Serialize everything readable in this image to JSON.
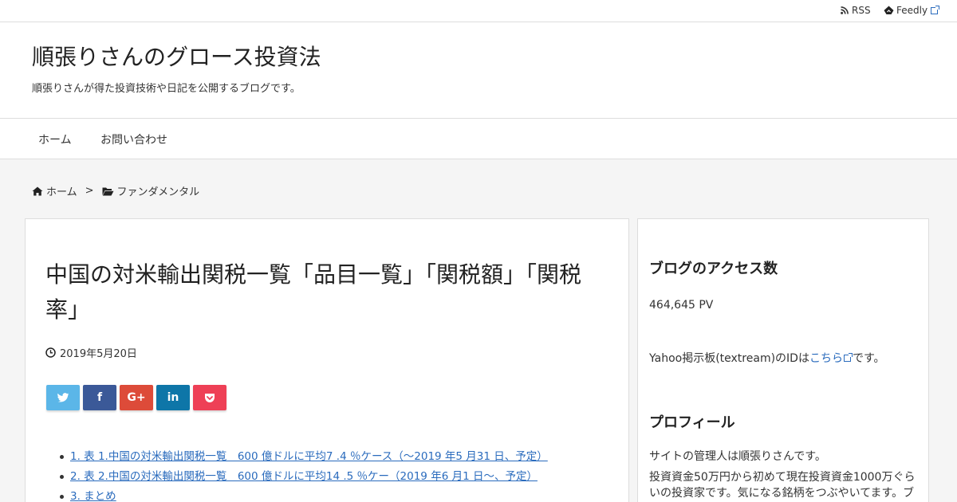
{
  "topbar": {
    "rss_label": "RSS",
    "feedly_label": "Feedly"
  },
  "header": {
    "site_title": "順張りさんのグロース投資法",
    "site_description": "順張りさんが得た投資技術や日記を公開するブログです。"
  },
  "nav": {
    "items": [
      {
        "label": "ホーム"
      },
      {
        "label": "お問い合わせ"
      }
    ]
  },
  "breadcrumb": {
    "home_label": "ホーム",
    "separator": ">",
    "category_label": "ファンダメンタル"
  },
  "article": {
    "title": "中国の対米輸出関税一覧「品目一覧」「関税額」「関税率」",
    "date": "2019年5月20日",
    "share_buttons": [
      {
        "label": "twitter-icon",
        "color": "#5bb6e8"
      },
      {
        "label": "f",
        "color": "#3b5998"
      },
      {
        "label": "G+",
        "color": "#dd4b39"
      },
      {
        "label": "in",
        "color": "#0e76a8"
      },
      {
        "label": "pocket-icon",
        "color": "#ee4056"
      }
    ],
    "toc": [
      "1. 表 1.中国の対米輸出関税一覧　600 億ドルに平均7 .4 ％ケース（～2019 年5 月31 日、予定）",
      "2. 表 2.中国の対米輸出関税一覧　600 億ドルに平均14 .5 ％ケー（2019 年6 月1 日～、予定）",
      "3. まとめ"
    ]
  },
  "sidebar": {
    "access_title": "ブログのアクセス数",
    "access_count": "464,645 PV",
    "yahoo_prefix": "Yahoo掲示板(textream)のIDは",
    "yahoo_link": "こちら",
    "yahoo_suffix": "です。",
    "profile_title": "プロフィール",
    "profile_line1": "サイトの管理人は順張りさんです。",
    "profile_line2": "投資資金50万円から初めて現在投資資金1000万ぐらいの投資家です。気になる銘柄をつぶやいてます。ブログは相場の毎日の時間以外で更新しています。"
  },
  "colors": {
    "link": "#2a6bbd",
    "background": "#f5f5f5"
  }
}
